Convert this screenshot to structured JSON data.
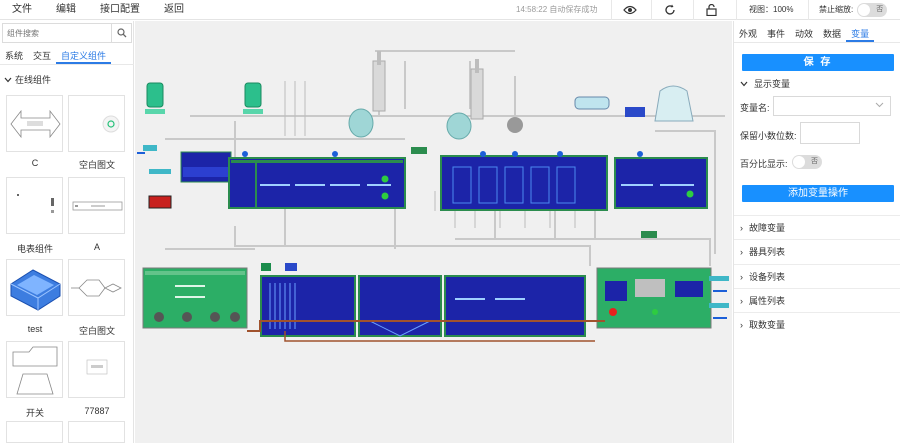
{
  "menu": [
    "文件",
    "编辑",
    "接口配置",
    "返回"
  ],
  "autosave": "14:58:22 自动保存成功",
  "toolbar": {
    "preview_icon": "eye-icon",
    "refresh_icon": "refresh-icon",
    "lock_icon": "unlock-icon"
  },
  "zoom": "视图：100%",
  "noscale": {
    "label": "禁止缩放:",
    "toggle": "否"
  },
  "left": {
    "search_placeholder": "组件搜索",
    "tabs": [
      "系统",
      "交互",
      "自定义组件"
    ],
    "section": "在线组件",
    "tiles": [
      "C",
      "空白图文",
      "电表组件",
      "A",
      "test",
      "空白图文",
      "开关",
      "77887"
    ]
  },
  "right": {
    "tabs": [
      "外观",
      "事件",
      "动效",
      "数据",
      "变量"
    ],
    "save": "保 存",
    "display_var": "显示变量",
    "var_name": "变量名:",
    "decimals": "保留小数位数:",
    "percent": "百分比显示:",
    "percent_toggle": "否",
    "add_var": "添加变量操作",
    "accordions": [
      "故障变量",
      "器具列表",
      "设备列表",
      "属性列表",
      "取数变量"
    ]
  },
  "colors": {
    "accent": "#1890ff",
    "tank_blue": "#1e22b8",
    "green": "#27a556",
    "pipe": "#c8c8c8"
  }
}
